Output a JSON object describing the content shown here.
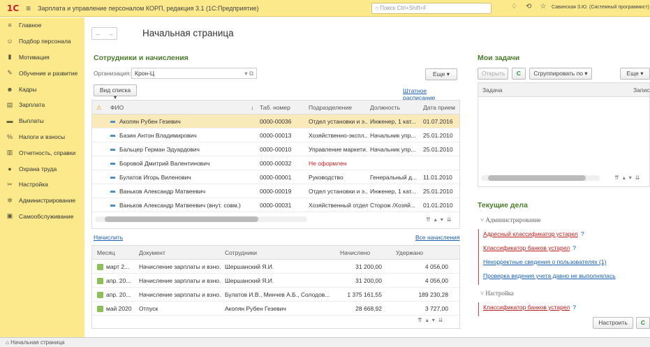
{
  "titlebar": {
    "logo": "1С",
    "title": "Зарплата и управление персоналом КОРП, редакция 3.1  (1С:Предприятие)",
    "search_placeholder": "Поиск Ctrl+Shift+F",
    "user": "Савинская З.Ю. (Системный программист)"
  },
  "sidebar": {
    "items": [
      {
        "label": "Главное",
        "icon": "menu-icon"
      },
      {
        "label": "Подбор персонала",
        "icon": "recruit-icon"
      },
      {
        "label": "Мотивация",
        "icon": "motivation-icon"
      },
      {
        "label": "Обучение и развитие",
        "icon": "education-icon"
      },
      {
        "label": "Кадры",
        "icon": "people-icon"
      },
      {
        "label": "Зарплата",
        "icon": "salary-icon"
      },
      {
        "label": "Выплаты",
        "icon": "payments-icon"
      },
      {
        "label": "Налоги и взносы",
        "icon": "percent-icon"
      },
      {
        "label": "Отчетность, справки",
        "icon": "reports-icon"
      },
      {
        "label": "Охрана труда",
        "icon": "safety-icon"
      },
      {
        "label": "Настройка",
        "icon": "wrench-icon"
      },
      {
        "label": "Администрирование",
        "icon": "gear-icon"
      },
      {
        "label": "Самообслуживание",
        "icon": "self-service-icon"
      }
    ]
  },
  "main": {
    "page_title": "Начальная страница",
    "employees": {
      "title": "Сотрудники и начисления",
      "org_label": "Организация:",
      "org_value": "Крон-Ц",
      "more": "Еще",
      "view_list": "Вид списка",
      "staff_link": "Штатное расписание",
      "columns": [
        "ФИО",
        "Таб. номер",
        "Подразделение",
        "Должность",
        "Дата прием"
      ],
      "rows": [
        {
          "name": "Акопян Рубен Гезевич",
          "tab": "0000-00036",
          "dept": "Отдел установки и э...",
          "pos": "Инженер, 1 кат...",
          "date": "01.07.2016"
        },
        {
          "name": "Базин Антон Владимирович",
          "tab": "0000-00013",
          "dept": "Хозяйственно-экспл...",
          "pos": "Начальник упр...",
          "date": "25.01.2010"
        },
        {
          "name": "Бальцер Герман Эдуардович",
          "tab": "0000-00010",
          "dept": "Управление маркети...",
          "pos": "Начальник упр...",
          "date": "25.01.2010"
        },
        {
          "name": "Боровой Дмитрий Валентинович",
          "tab": "0000-00032",
          "dept": "Не оформлен",
          "pos": "",
          "date": ""
        },
        {
          "name": "Булатов Игорь Виленович",
          "tab": "0000-00001",
          "dept": "Руководство",
          "pos": "Генеральный д...",
          "date": "11.01.2010"
        },
        {
          "name": "Ваньков Александр Матвеевич",
          "tab": "0000-00019",
          "dept": "Отдел установки и э...",
          "pos": "Инженер, 1 кат...",
          "date": "25.01.2010"
        },
        {
          "name": "Ваньков Александр Матвеевич (внут. совм.)",
          "tab": "0000-00031",
          "dept": "Хозяйственный отдел",
          "pos": "Сторож /Хозяй...",
          "date": "01.01.2010"
        }
      ]
    },
    "accrue_link": "Начислить",
    "all_accruals_link": "Все начисления",
    "accruals": {
      "columns": [
        "Месяц",
        "Документ",
        "Сотрудники",
        "Начислено",
        "Удержано"
      ],
      "rows": [
        {
          "month": "март 2...",
          "doc": "Начисление зарплаты и взно...",
          "emp": "Шершанский Я.И.",
          "accr": "31 200,00",
          "ded": "4 056,00"
        },
        {
          "month": "апр. 20...",
          "doc": "Начисление зарплаты и взно...",
          "emp": "Шершанский Я.И.",
          "accr": "31 200,00",
          "ded": "4 056,00"
        },
        {
          "month": "апр. 20...",
          "doc": "Начисление зарплаты и взно...",
          "emp": "Булатов И.В., Минчев А.Б., Солодов...",
          "accr": "1 375 161,55",
          "ded": "189 230,28"
        },
        {
          "month": "май 2020",
          "doc": "Отпуск",
          "emp": "Акопян Рубен Гезевич",
          "accr": "28 668,92",
          "ded": "3 727,00"
        }
      ]
    }
  },
  "tasks": {
    "title": "Мои задачи",
    "open": "Открыть",
    "group": "Сгруппировать по",
    "more": "Еще",
    "columns": [
      "Задача",
      "Запис"
    ]
  },
  "current": {
    "title": "Текущие дела",
    "groups": [
      {
        "name": "Администрирование",
        "items": [
          {
            "text": "Адресный классификатор устарел",
            "q": "?",
            "color": "#c02020"
          },
          {
            "text": "Классификатор банков устарел",
            "q": "?",
            "color": "#c02020"
          },
          {
            "text": "Некорректные сведения о пользователях (1)",
            "q": "",
            "color": "#1a5fb4"
          },
          {
            "text": "Проверка ведения учета давно не выполнялась",
            "q": "",
            "color": "#1a5fb4"
          }
        ]
      },
      {
        "name": "Настройка",
        "items": [
          {
            "text": "Классификатор банков устарел",
            "q": "?",
            "color": "#c02020"
          }
        ]
      }
    ],
    "configure": "Настроить"
  },
  "bottombar": {
    "label": "Начальная страница"
  },
  "colors": {
    "accent": "#fbe98c",
    "section_green": "#4a7c2c",
    "link": "#1a5fb4",
    "warning": "#c02020"
  }
}
